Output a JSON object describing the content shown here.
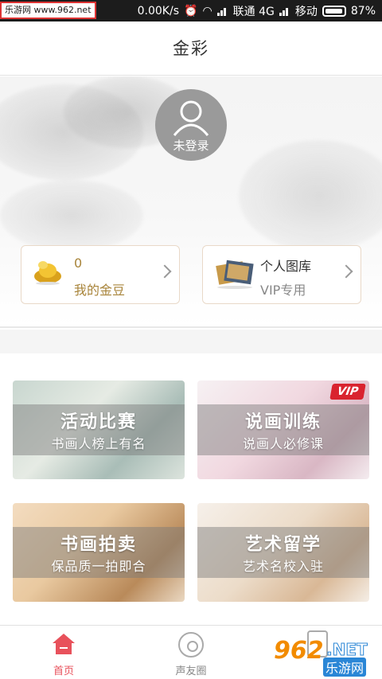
{
  "status_bar": {
    "watermark": "乐游网 www.962.net",
    "speed": "0.00K/s",
    "carrier1": "联通 4G",
    "carrier2": "移动",
    "battery": "87%"
  },
  "header": {
    "title": "金彩"
  },
  "profile": {
    "avatar_label": "未登录",
    "gold_card": {
      "value": "0",
      "label": "我的金豆"
    },
    "gallery_card": {
      "title": "个人图库",
      "subtitle": "VIP专用"
    }
  },
  "tiles": [
    {
      "title": "活动比赛",
      "subtitle": "书画人榜上有名"
    },
    {
      "title": "说画训练",
      "subtitle": "说画人必修课",
      "badge": "VIP"
    },
    {
      "title": "书画拍卖",
      "subtitle": "保品质一拍即合"
    },
    {
      "title": "艺术留学",
      "subtitle": "艺术名校入驻"
    }
  ],
  "bottom_nav": {
    "home": "首页",
    "circle": "声友圈"
  },
  "watermark_logo": {
    "num": "962",
    "net": ".NET",
    "cn": "乐游网"
  },
  "colors": {
    "accent": "#e8515b",
    "gold": "#a8843a",
    "vip": "#d9232f"
  }
}
